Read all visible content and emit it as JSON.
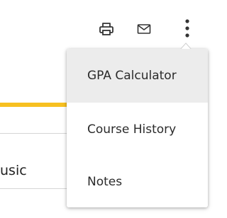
{
  "toolbar": {
    "icons": [
      "print-icon",
      "mail-icon",
      "more-vertical-icon"
    ]
  },
  "page": {
    "row_text": "usic"
  },
  "menu": {
    "items": [
      {
        "label": "GPA Calculator",
        "highlighted": true
      },
      {
        "label": "Course History",
        "highlighted": false
      },
      {
        "label": "Notes",
        "highlighted": false
      }
    ]
  },
  "colors": {
    "accent": "#f7c020",
    "menu_highlight": "#ececec",
    "icon": "#333333"
  }
}
